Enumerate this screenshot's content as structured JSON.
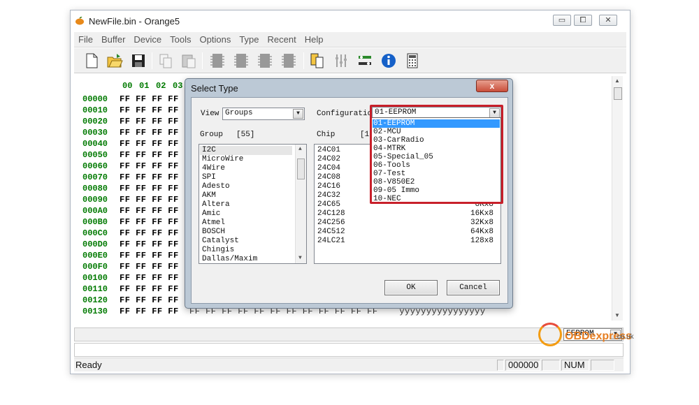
{
  "window": {
    "title": "NewFile.bin - Orange5",
    "controls": [
      "▭",
      "⧠",
      "✕"
    ]
  },
  "menu": [
    "File",
    "Buffer",
    "Device",
    "Tools",
    "Options",
    "Type",
    "Recent",
    "Help"
  ],
  "toolbar_icons": [
    "new-file-icon",
    "open-folder-icon",
    "save-icon",
    "copy-icon",
    "paste-icon",
    "chip-read-icon",
    "chip-verify-icon",
    "chip-write-icon",
    "chip-erase-icon",
    "device-icon",
    "settings-icon",
    "adapter-icon",
    "info-icon",
    "calculator-icon"
  ],
  "hex": {
    "columns": [
      "00",
      "01",
      "02",
      "03"
    ],
    "addresses": [
      "00000",
      "00010",
      "00020",
      "00030",
      "00040",
      "00050",
      "00060",
      "00070",
      "00080",
      "00090",
      "000A0",
      "000B0",
      "000C0",
      "000D0",
      "000E0",
      "000F0",
      "00100",
      "00110",
      "00120",
      "00130"
    ],
    "row_bytes": "FF FF FF FF",
    "last_row_tail": "FF FF FF FF FF FF FF FF FF FF FF FF    ÿÿÿÿÿÿÿÿÿÿÿÿÿÿÿÿ"
  },
  "dialog": {
    "title": "Select Type",
    "close": "x",
    "view_label": "View",
    "view_value": "Groups",
    "configuration_label": "Configuratio",
    "configuration_value": "01-EEPROM",
    "group_label": "Group",
    "group_count": "[55]",
    "chip_label": "Chip",
    "chip_count": "[11",
    "groups": [
      "I2C",
      "MicroWire",
      "4Wire",
      "SPI",
      "Adesto",
      "AKM",
      "Altera",
      "Amic",
      "Atmel",
      "BOSCH",
      "Catalyst",
      "Chingis",
      "Dallas/Maxim"
    ],
    "chips": [
      {
        "name": "24C01",
        "size": ""
      },
      {
        "name": "24C02",
        "size": ""
      },
      {
        "name": "24C04",
        "size": ""
      },
      {
        "name": "24C08",
        "size": ""
      },
      {
        "name": "24C16",
        "size": ""
      },
      {
        "name": "24C32",
        "size": ""
      },
      {
        "name": "24C65",
        "size": "8Kx8"
      },
      {
        "name": "24C128",
        "size": "16Kx8"
      },
      {
        "name": "24C256",
        "size": "32Kx8"
      },
      {
        "name": "24C512",
        "size": "64Kx8"
      },
      {
        "name": "24LC21",
        "size": "128x8"
      }
    ],
    "config_options": [
      "01-EEPROM",
      "02-MCU",
      "03-CarRadio",
      "04-MTRK",
      "05-Special_05",
      "06-Tools",
      "07-Test",
      "08-V850E2",
      "09-05 Immo",
      "10-NEC"
    ],
    "ok": "OK",
    "cancel": "Cancel"
  },
  "bottom_combo": "EEPROM",
  "status": {
    "text": "Ready",
    "offset": "000000",
    "num": "NUM"
  },
  "watermark": {
    "brand": "OBDexpress",
    "domain": ".co.uk"
  }
}
